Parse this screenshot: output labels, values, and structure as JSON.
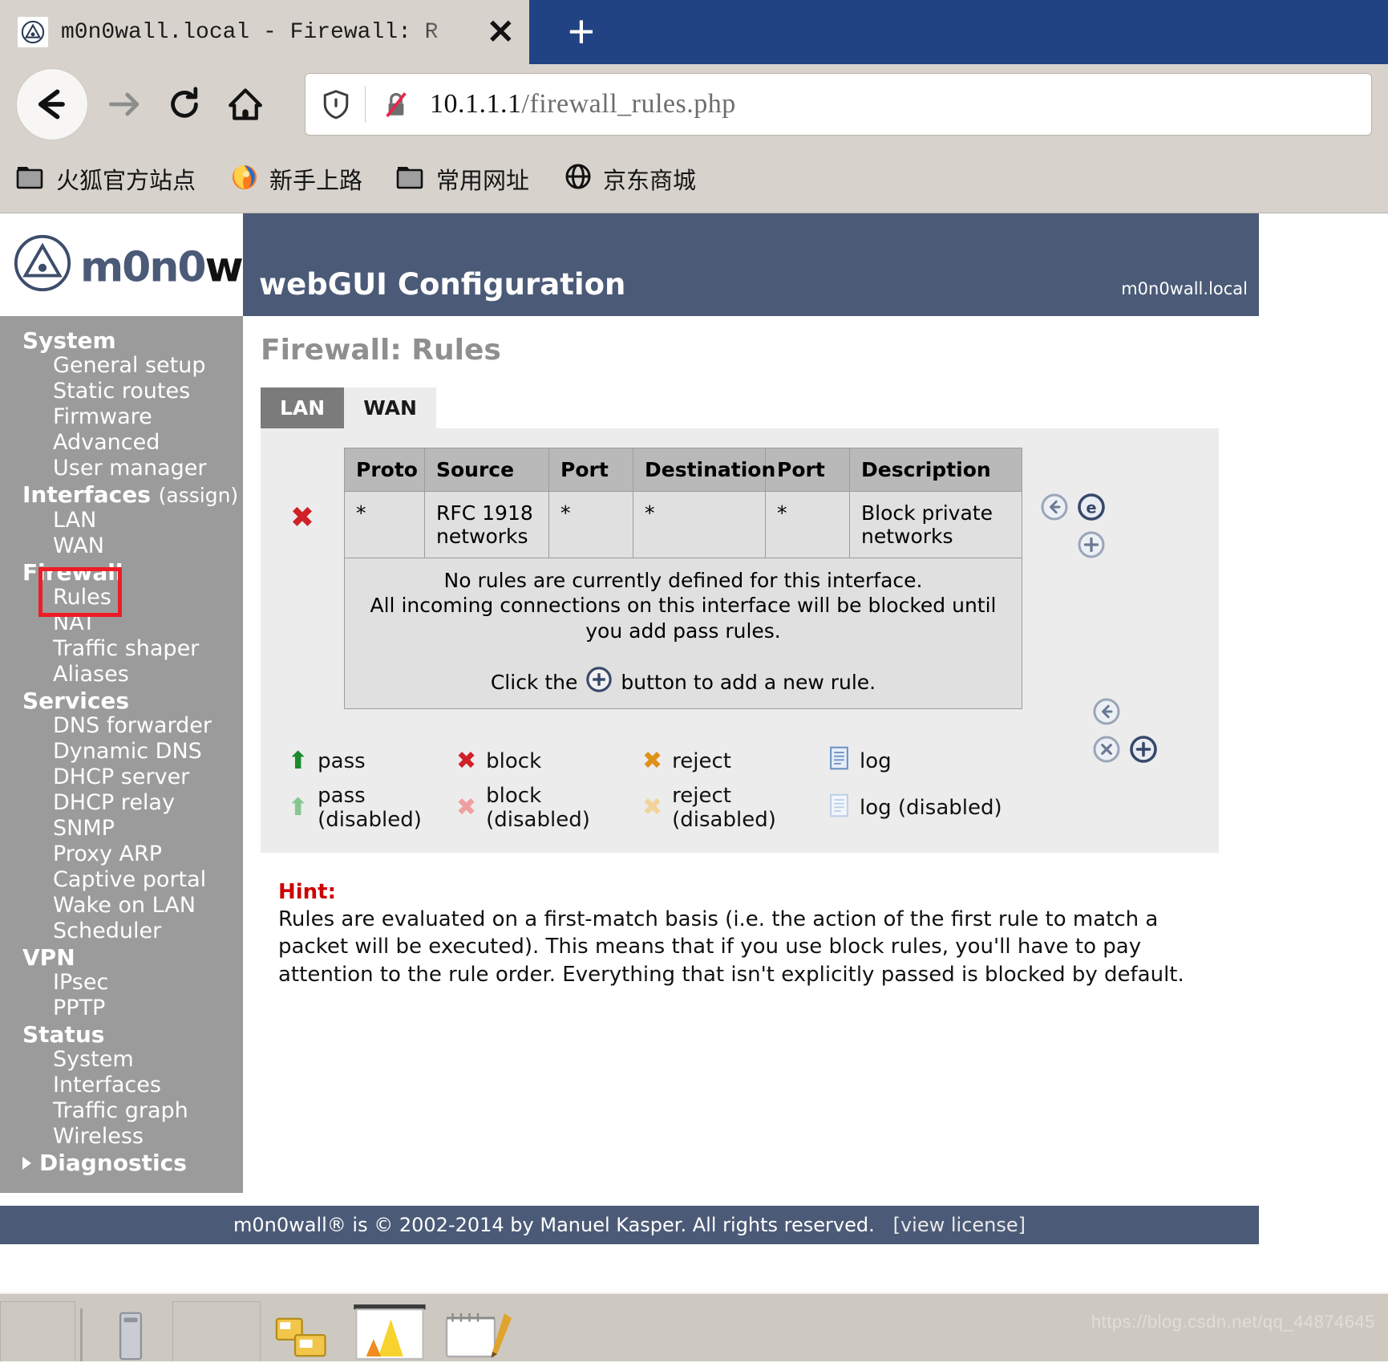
{
  "browser": {
    "tab": {
      "title": "m0n0wall.local - Firewall: R",
      "close_label": "✕",
      "favicon_name": "m0n0wall-favicon"
    },
    "newtab_label": "+",
    "nav": {
      "back_label": "←",
      "forward_label": "→",
      "reload_label": "↻",
      "home_label": "⌂"
    },
    "url": {
      "host": "10.1.1.1",
      "path": "/firewall_rules.php",
      "full": "10.1.1.1/firewall_rules.php"
    },
    "bookmarks": [
      {
        "label": "火狐官方站点",
        "icon": "folder-icon"
      },
      {
        "label": "新手上路",
        "icon": "firefox-icon"
      },
      {
        "label": "常用网址",
        "icon": "folder-icon"
      },
      {
        "label": "京东商城",
        "icon": "globe-icon"
      }
    ]
  },
  "app": {
    "logo_text_blue": "m0n0",
    "logo_text_black": "wall",
    "logo_reg": "®",
    "banner_title": "webGUI Configuration",
    "banner_host": "m0n0wall.local",
    "page_title": "Firewall: Rules"
  },
  "sidebar": {
    "groups": [
      {
        "label": "System",
        "items": [
          "General setup",
          "Static routes",
          "Firmware",
          "Advanced",
          "User manager"
        ]
      },
      {
        "label": "Interfaces",
        "suffix": "(assign)",
        "items": [
          "LAN",
          "WAN"
        ]
      },
      {
        "label": "Firewall",
        "items": [
          "Rules",
          "NAT",
          "Traffic shaper",
          "Aliases"
        ]
      },
      {
        "label": "Services",
        "items": [
          "DNS forwarder",
          "Dynamic DNS",
          "DHCP server",
          "DHCP relay",
          "SNMP",
          "Proxy ARP",
          "Captive portal",
          "Wake on LAN",
          "Scheduler"
        ]
      },
      {
        "label": "VPN",
        "items": [
          "IPsec",
          "PPTP"
        ]
      },
      {
        "label": "Status",
        "items": [
          "System",
          "Interfaces",
          "Traffic graph",
          "Wireless"
        ]
      },
      {
        "label": "Diagnostics",
        "caret": true,
        "items": []
      }
    ],
    "highlight_color": "#ee1c25"
  },
  "main": {
    "tabs": [
      {
        "label": "LAN",
        "selected": true
      },
      {
        "label": "WAN",
        "selected": false
      }
    ],
    "table": {
      "headers": [
        "Proto",
        "Source",
        "Port",
        "Destination",
        "Port",
        "Description"
      ],
      "rows": [
        {
          "action_icon": "block-x-icon",
          "proto": "*",
          "source": "RFC 1918 networks",
          "src_port": "*",
          "destination": "*",
          "dst_port": "*",
          "description": "Block private networks"
        }
      ],
      "empty_line1": "No rules are currently defined for this interface.",
      "empty_line2": "All incoming connections on this interface will be blocked until you add pass rules.",
      "empty_click_before": "Click the",
      "empty_click_after": "button to add a new rule."
    },
    "row_actions": [
      {
        "name": "move-up-icon",
        "glyph": "←"
      },
      {
        "name": "edit-rule-icon",
        "glyph": "e"
      },
      {
        "name": "add-rule-icon",
        "glyph": "+"
      }
    ],
    "bottom_actions": [
      {
        "name": "move-rule-icon",
        "glyph": "←"
      },
      {
        "name": "delete-rule-icon",
        "glyph": "✕"
      },
      {
        "name": "add-rule-bottom-icon",
        "glyph": "+"
      }
    ],
    "legend": [
      {
        "label": "pass",
        "icon": "arrow-up-icon",
        "color": "#1b8a2e"
      },
      {
        "label": "block",
        "icon": "x-icon",
        "color": "#cf2127"
      },
      {
        "label": "reject",
        "icon": "x-icon",
        "color": "#e09119"
      },
      {
        "label": "log",
        "icon": "log-icon",
        "color": "#6e92c4"
      },
      {
        "label": "pass (disabled)",
        "icon": "arrow-up-icon",
        "color": "#86c690"
      },
      {
        "label": "block (disabled)",
        "icon": "x-icon",
        "color": "#eda09f"
      },
      {
        "label": "reject (disabled)",
        "icon": "x-icon",
        "color": "#f2d39a"
      },
      {
        "label": "log (disabled)",
        "icon": "log-icon",
        "color": "#bcd0e8"
      }
    ],
    "hint": {
      "label": "Hint:",
      "text": "Rules are evaluated on a first-match basis (i.e. the action of the first rule to match a packet will be executed). This means that if you use block rules, you'll have to pay attention to the rule order. Everything that isn't explicitly passed is blocked by default."
    }
  },
  "footer": {
    "text": "m0n0wall® is © 2002-2014 by Manuel Kasper. All rights reserved.",
    "license_link": "[view license]"
  },
  "taskbar": {
    "watermark": "https://blog.csdn.net/qq_44874645"
  }
}
